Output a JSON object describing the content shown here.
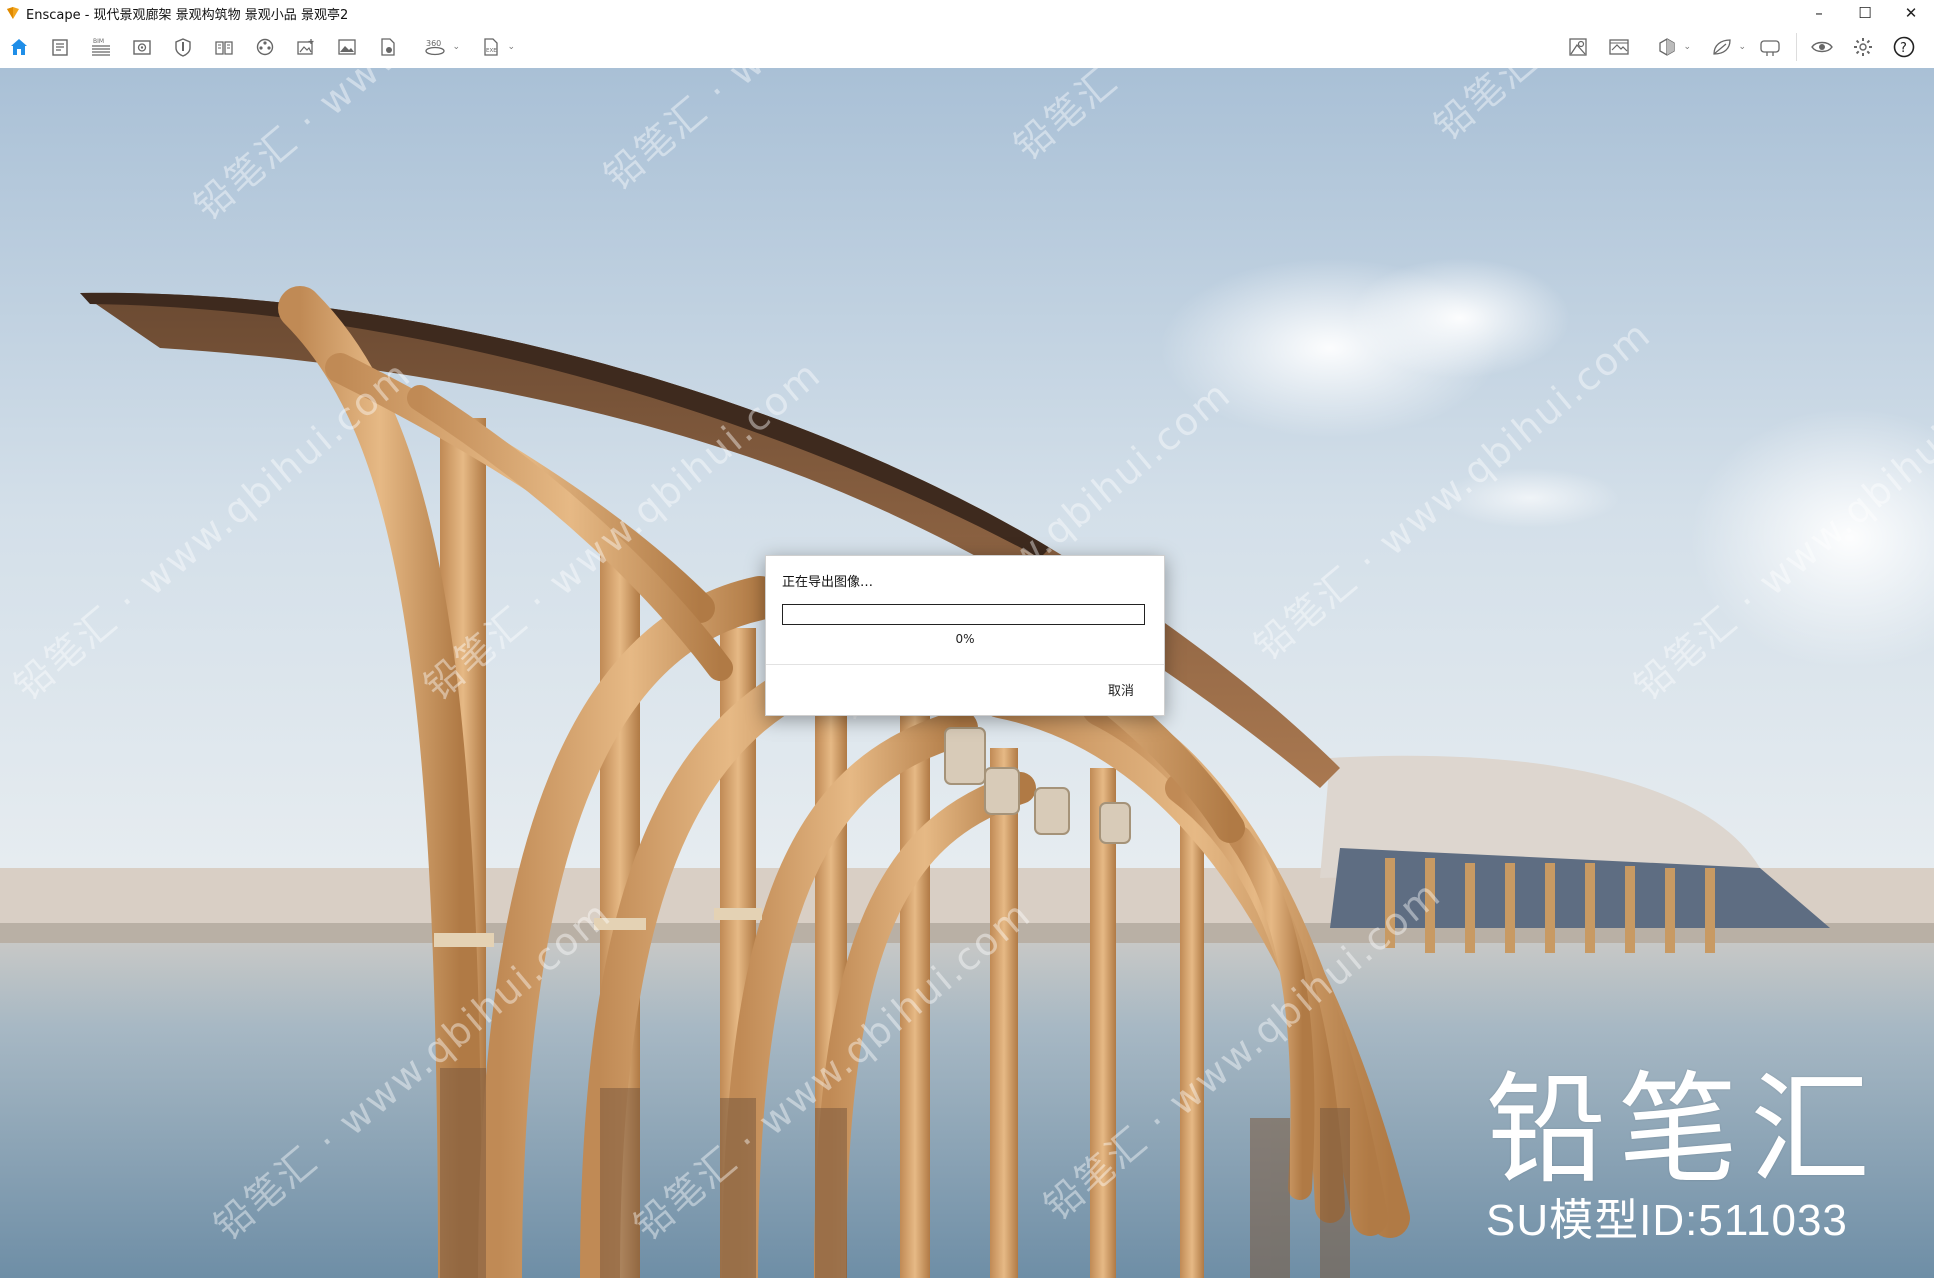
{
  "window": {
    "title": "Enscape - 现代景观廊架 景观构筑物 景观小品 景观亭2",
    "minimize": "–",
    "maximize": "☐",
    "close": "✕"
  },
  "toolbar": {
    "left_icons": [
      "home-icon",
      "document-icon",
      "bim-icon",
      "camera-view-icon",
      "capture-icon",
      "book-icon",
      "video-icon",
      "screenshot-icon",
      "image-icon",
      "export-file-icon",
      "panorama-360-icon",
      "exe-export-icon"
    ],
    "right_icons": [
      "asset-library-icon",
      "image-settings-icon",
      "cube-view-icon",
      "leaf-material-icon",
      "screen-share-icon",
      "visual-settings-icon",
      "settings-gear-icon",
      "help-icon"
    ],
    "collapse_glyph": "^"
  },
  "dialog": {
    "title": "正在导出图像…",
    "progress_text": "0%",
    "progress_value": 0,
    "cancel_label": "取消"
  },
  "watermark": {
    "brand_name": "铅笔汇",
    "model_id": "SU模型ID:511033",
    "overlay_cn": "铅笔汇",
    "overlay_url": "www.qbihui.com"
  },
  "colors": {
    "accent": "#3b8bd6",
    "home_icon": "#1f8ee8",
    "app_icon": "#f2a51e"
  }
}
